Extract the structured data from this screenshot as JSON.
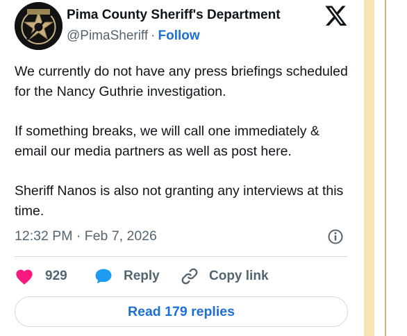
{
  "account": {
    "name": "Pima County Sheriff's Department",
    "handle": "@PimaSheriff",
    "separator": "·",
    "follow_label": "Follow",
    "avatar_icon": "sheriff-star-badge-icon",
    "platform_icon": "x-logo-icon"
  },
  "post": {
    "paragraphs": [
      "We currently do not have any press briefings scheduled for the Nancy Guthrie investigation.",
      "If something breaks, we will call one immediately & email our media partners as well as post here.",
      "Sheriff Nanos is also not granting any interviews at this time."
    ],
    "timestamp": "12:32 PM · Feb 7, 2026",
    "info_icon": "info-icon"
  },
  "actions": {
    "like_count": "929",
    "reply_label": "Reply",
    "copy_link_label": "Copy link",
    "like_icon": "heart-icon",
    "reply_icon": "speech-bubble-icon",
    "copy_icon": "link-icon"
  },
  "read_replies_label": "Read 179 replies",
  "colors": {
    "accent": "#1d6fd1",
    "like": "#f91880",
    "muted": "#536471",
    "side_strip": "#f6e6b3"
  }
}
